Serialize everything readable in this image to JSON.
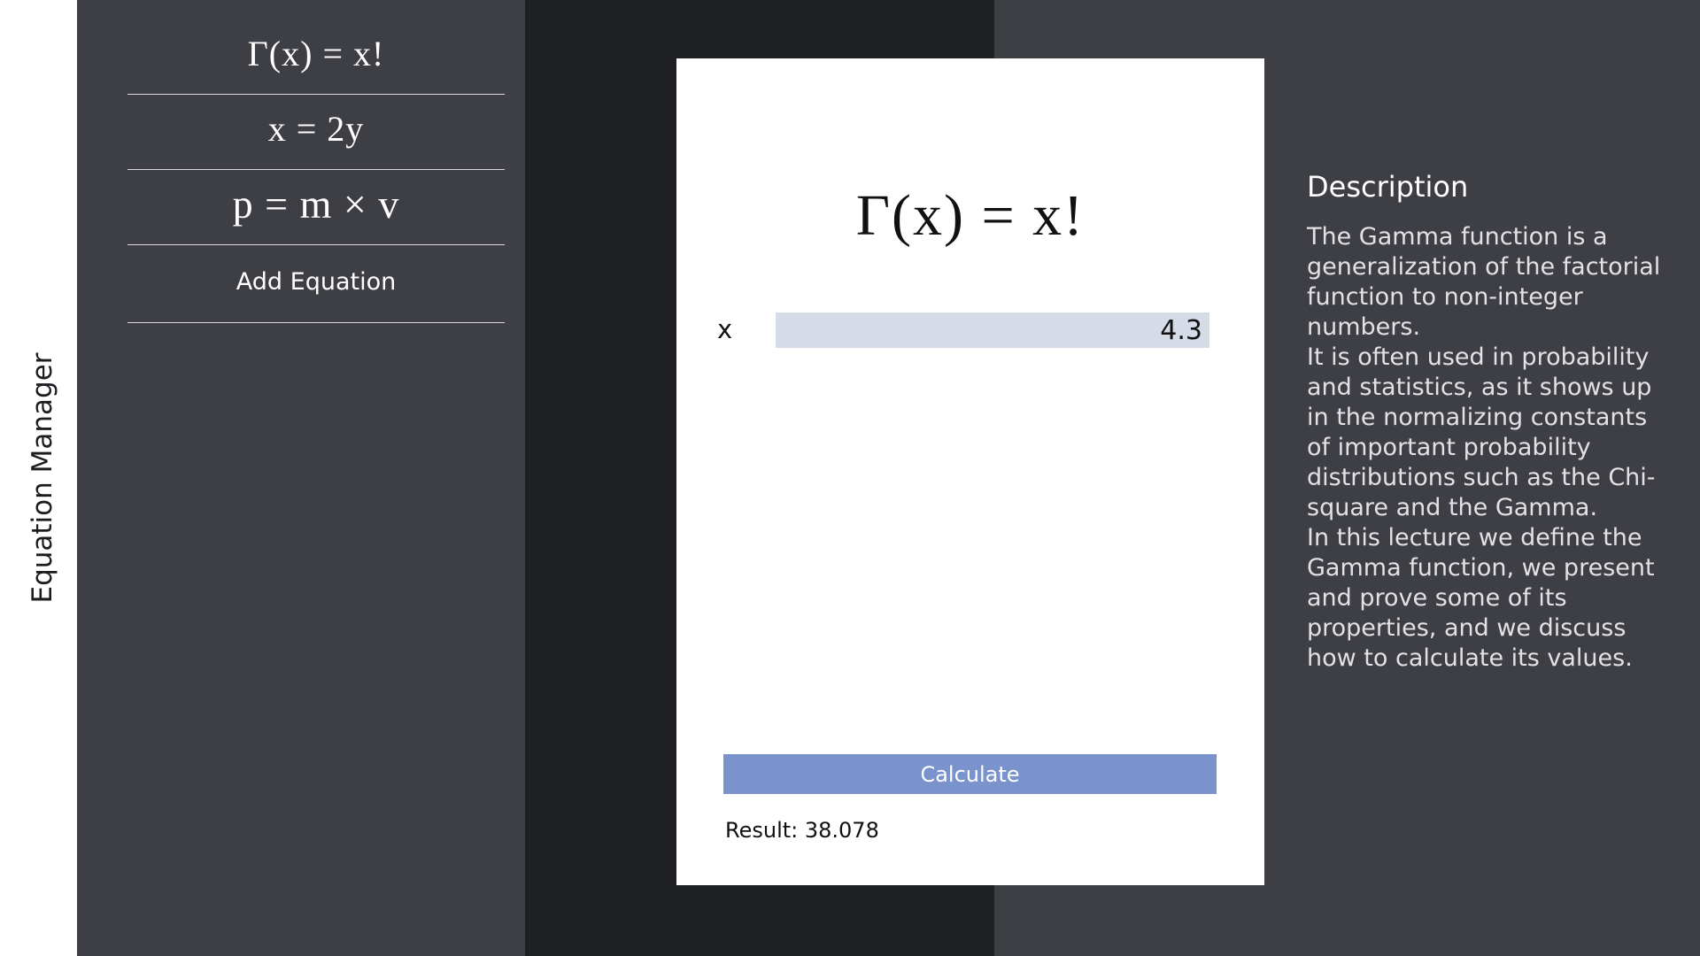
{
  "app": {
    "title": "Equation Manager"
  },
  "sidebar": {
    "equations": [
      {
        "label": "Γ(x) = x!"
      },
      {
        "label": "x = 2y"
      },
      {
        "label": "p = m × v"
      }
    ],
    "add_label": "Add Equation"
  },
  "calculator": {
    "equation": "Γ(x) = x!",
    "variables": [
      {
        "name": "x",
        "value": "4.3"
      }
    ],
    "calculate_label": "Calculate",
    "result_text": "Result: 38.078"
  },
  "description": {
    "title": "Description",
    "paragraphs": [
      "The Gamma function is a generalization of the factorial function to non-integer numbers.",
      "It is often used in probability and statistics, as it shows up in the normalizing constants of important probability distributions such as the Chi-square and the Gamma.",
      "In this lecture we define the Gamma function, we present and prove some of its properties, and we discuss how to calculate its values."
    ]
  },
  "colors": {
    "sidebar_bg": "#3e3f45",
    "middle_bg": "#1f2024",
    "input_bg": "#d5dce7",
    "accent": "#7b93cd"
  }
}
